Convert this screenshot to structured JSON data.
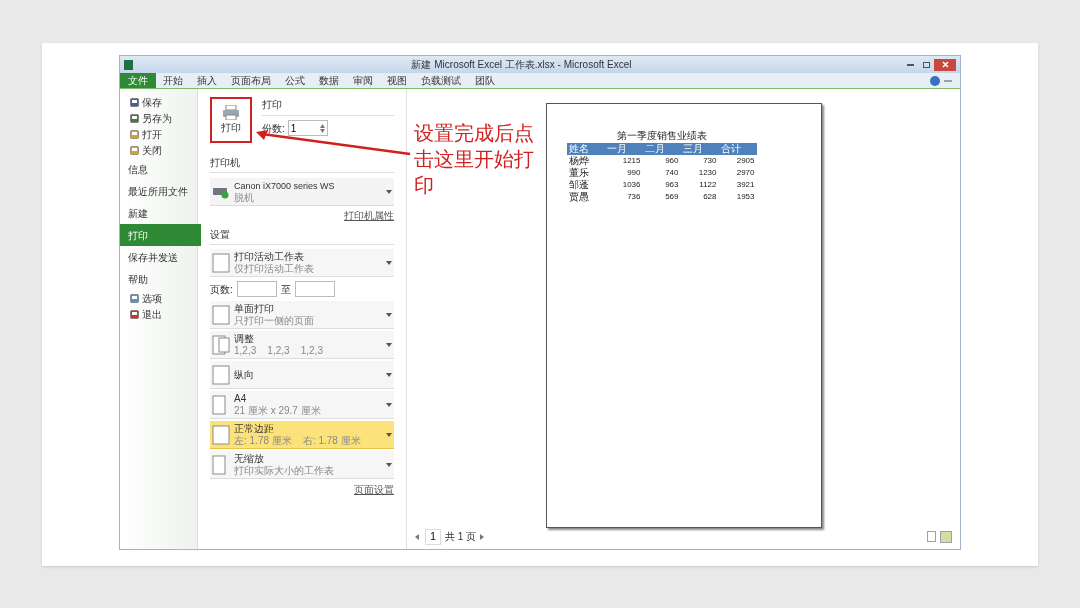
{
  "window": {
    "title": "新建 Microsoft Excel 工作表.xlsx - Microsoft Excel"
  },
  "ribbon_tabs": [
    {
      "label": "文件",
      "selected": true
    },
    {
      "label": "开始",
      "selected": false
    },
    {
      "label": "插入",
      "selected": false
    },
    {
      "label": "页面布局",
      "selected": false
    },
    {
      "label": "公式",
      "selected": false
    },
    {
      "label": "数据",
      "selected": false
    },
    {
      "label": "审阅",
      "selected": false
    },
    {
      "label": "视图",
      "selected": false
    },
    {
      "label": "负载测试",
      "selected": false
    },
    {
      "label": "团队",
      "selected": false
    }
  ],
  "sidebar": {
    "items": [
      {
        "label": "保存",
        "kind": "command",
        "selected": false
      },
      {
        "label": "另存为",
        "kind": "command",
        "selected": false
      },
      {
        "label": "打开",
        "kind": "command",
        "selected": false
      },
      {
        "label": "关闭",
        "kind": "command",
        "selected": false
      },
      {
        "label": "信息",
        "kind": "section",
        "selected": false
      },
      {
        "label": "最近所用文件",
        "kind": "section",
        "selected": false
      },
      {
        "label": "新建",
        "kind": "section",
        "selected": false
      },
      {
        "label": "打印",
        "kind": "section",
        "selected": true
      },
      {
        "label": "保存并发送",
        "kind": "section",
        "selected": false
      },
      {
        "label": "帮助",
        "kind": "section",
        "selected": false
      },
      {
        "label": "选项",
        "kind": "command",
        "selected": false
      },
      {
        "label": "退出",
        "kind": "command",
        "selected": false
      }
    ]
  },
  "print_panel": {
    "print_button": "打印",
    "heading": "打印",
    "copies_label": "份数:",
    "copies_value": "1",
    "printer_heading": "打印机",
    "printer": {
      "name": "Canon iX7000 series WS",
      "status": "脱机"
    },
    "printer_properties": "打印机属性",
    "settings_heading": "设置",
    "settings": [
      {
        "kind": "dropdown",
        "title": "打印活动工作表",
        "subtitle": "仅打印活动工作表",
        "highlighted": false
      },
      {
        "kind": "page_range",
        "label": "页数:",
        "to": "至"
      },
      {
        "kind": "dropdown",
        "title": "单面打印",
        "subtitle": "只打印一侧的页面",
        "highlighted": false
      },
      {
        "kind": "dropdown",
        "title": "调整",
        "subtitle": "1,2,3    1,2,3    1,2,3",
        "highlighted": false
      },
      {
        "kind": "dropdown",
        "title": "纵向",
        "highlighted": false
      },
      {
        "kind": "dropdown",
        "title": "A4",
        "subtitle": "21 厘米 x 29.7 厘米",
        "highlighted": false
      },
      {
        "kind": "dropdown",
        "title": "正常边距",
        "subtitle": "左: 1.78 厘米    右: 1.78 厘米",
        "highlighted": true
      },
      {
        "kind": "dropdown",
        "title": "无缩放",
        "subtitle": "打印实际大小的工作表",
        "highlighted": false
      }
    ],
    "page_setup": "页面设置"
  },
  "annotation": {
    "text": "设置完成后点击这里开始打印"
  },
  "preview": {
    "table": {
      "title": "第一季度销售业绩表",
      "columns": [
        "姓名",
        "一月",
        "二月",
        "三月",
        "合计"
      ],
      "rows": [
        [
          "杨烨",
          "1215",
          "960",
          "730",
          "2905"
        ],
        [
          "董乐",
          "990",
          "740",
          "1230",
          "2970"
        ],
        [
          "邹蓬",
          "1036",
          "963",
          "1122",
          "3921"
        ],
        [
          "贾愚",
          "736",
          "569",
          "628",
          "1953"
        ]
      ]
    },
    "page_nav": {
      "current": "1",
      "total": "共 1 页"
    }
  }
}
